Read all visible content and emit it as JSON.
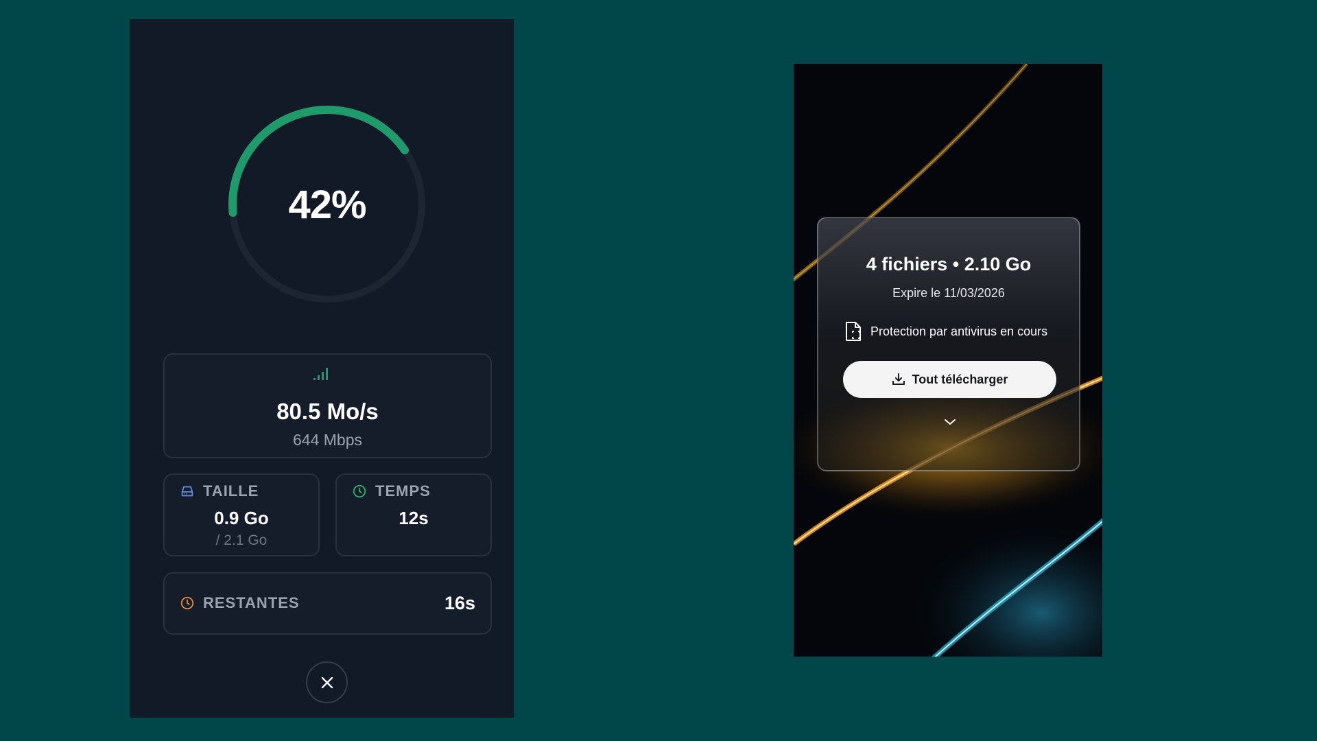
{
  "colors": {
    "page_background": "#01474a",
    "panel_background": "#111a26",
    "progress_accent": "#1f9a6a",
    "size_icon": "#5b8de0",
    "time_icon": "#22b36b",
    "remaining_icon": "#e38a3c"
  },
  "progress": {
    "percent_value": 0.42,
    "percent_label": "42%"
  },
  "speed": {
    "icon": "signal-bars-icon",
    "value": "80.5 Mo/s",
    "sub": "644 Mbps"
  },
  "size_card": {
    "icon": "drive-icon",
    "label": "TAILLE",
    "value": "0.9 Go",
    "sub": "/ 2.1 Go"
  },
  "time_card": {
    "icon": "clock-icon",
    "label": "TEMPS",
    "value": "12s"
  },
  "remaining_card": {
    "icon": "clock-icon",
    "label": "RESTANTES",
    "value": "16s"
  },
  "cancel": {
    "icon": "close-icon"
  },
  "share": {
    "title": "4 fichiers • 2.10 Go",
    "expiry": "Expire le 11/03/2026",
    "scan_icon": "file-scan-icon",
    "scan_text": "Protection par antivirus en cours",
    "download_icon": "download-icon",
    "download_label": "Tout télécharger",
    "expand_icon": "chevron-down-icon"
  }
}
